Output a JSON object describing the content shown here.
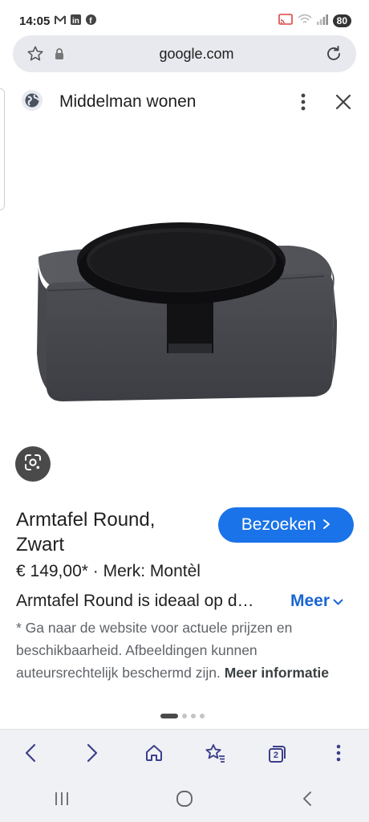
{
  "status_bar": {
    "time": "14:05",
    "left_icons": [
      "gmail-icon",
      "linkedin-icon",
      "facebook-icon"
    ],
    "right_icons": [
      "cast-icon",
      "wifi-icon",
      "signal-icon"
    ],
    "battery": "80"
  },
  "url_bar": {
    "url": "google.com"
  },
  "sheet": {
    "site_name": "Middelman wonen"
  },
  "product": {
    "title": "Armtafel Round, Zwart",
    "visit_label": "Bezoeken",
    "price_line": "€ 149,00* · Merk: Montèl",
    "description": "Armtafel Round is ideaal op d…",
    "more_label": "Meer",
    "disclaimer": "* Ga naar de website voor actuele prijzen en beschikbaarheid. Afbeeldingen kunnen auteursrechtelijk beschermd zijn.",
    "disclaimer_link": "Meer informatie"
  },
  "carousel": {
    "pages": 4,
    "active": 0
  },
  "toolbar": {
    "tabs_count": "2"
  },
  "colors": {
    "accent": "#1a73e8",
    "link": "#1a66d2"
  }
}
